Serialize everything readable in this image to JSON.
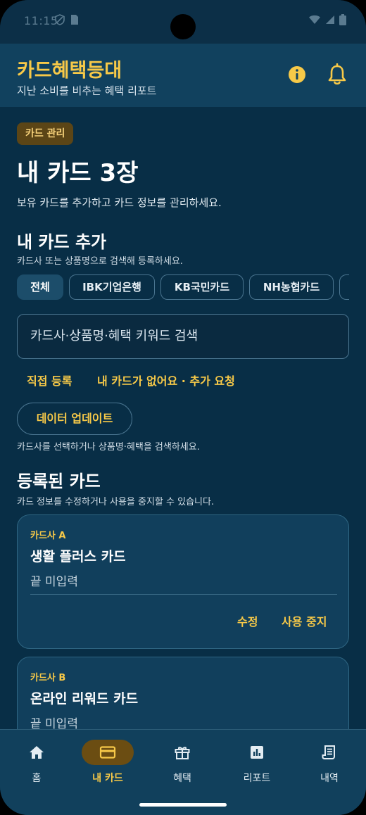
{
  "status_bar": {
    "time": "11:15",
    "icons_left": [
      "shield-icon",
      "sim-card-icon"
    ],
    "icons_right": [
      "wifi-icon",
      "signal-icon",
      "battery-icon"
    ]
  },
  "header": {
    "title": "카드혜택등대",
    "subtitle": "지난 소비를 비추는 혜택 리포트",
    "actions": [
      "info-icon",
      "bell-icon"
    ]
  },
  "main": {
    "section_chip": "카드 관리",
    "title": "내 카드 3장",
    "description": "보유 카드를 추가하고 카드 정보를 관리하세요."
  },
  "add_card": {
    "title": "내 카드 추가",
    "description": "카드사 또는 상품명으로 검색해 등록하세요.",
    "filters": [
      {
        "label": "전체",
        "selected": true
      },
      {
        "label": "IBK기업은행",
        "selected": false
      },
      {
        "label": "KB국민카드",
        "selected": false
      },
      {
        "label": "NH농협카드",
        "selected": false
      },
      {
        "label": "",
        "selected": false
      }
    ],
    "search_placeholder": "카드사·상품명·혜택 키워드 검색",
    "manual_register": "직접 등록",
    "request_add": "내 카드가 없어요 · 추가 요청",
    "update_button": "데이터 업데이트",
    "hint": "카드사를 선택하거나 상품명·혜택을 검색하세요."
  },
  "registered": {
    "title": "등록된 카드",
    "description": "카드 정보를 수정하거나 사용을 중지할 수 있습니다.",
    "cards": [
      {
        "issuer": "카드사 A",
        "name": "생활 플러스 카드",
        "last_digits": "끝 미입력",
        "edit": "수정",
        "suspend": "사용 중지"
      },
      {
        "issuer": "카드사 B",
        "name": "온라인 리워드 카드",
        "last_digits": "끝 미입력"
      }
    ]
  },
  "bottom_nav": {
    "items": [
      {
        "label": "홈",
        "icon": "home-icon",
        "active": false
      },
      {
        "label": "내 카드",
        "icon": "credit-card-icon",
        "active": true
      },
      {
        "label": "혜택",
        "icon": "gift-icon",
        "active": false
      },
      {
        "label": "리포트",
        "icon": "bar-chart-icon",
        "active": false
      },
      {
        "label": "내역",
        "icon": "receipt-icon",
        "active": false
      }
    ]
  },
  "colors": {
    "accent": "#f7c948",
    "background": "#082e46",
    "header": "#11415e",
    "card": "#113f5c"
  }
}
